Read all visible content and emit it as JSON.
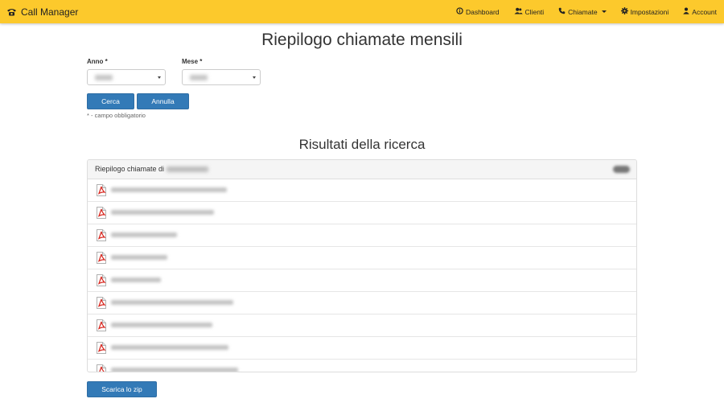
{
  "app": {
    "brand": "Call Manager",
    "brand_icon": "phone-icon",
    "accent_color": "#fcc92c",
    "primary_button_color": "#337ab7"
  },
  "nav": [
    {
      "label": "Dashboard",
      "icon": "info-circle-icon"
    },
    {
      "label": "Clienti",
      "icon": "users-icon"
    },
    {
      "label": "Chiamate",
      "icon": "phone-icon",
      "dropdown": true
    },
    {
      "label": "Impostazioni",
      "icon": "gear-icon"
    },
    {
      "label": "Account",
      "icon": "user-icon"
    }
  ],
  "page": {
    "title": "Riepilogo chiamate mensili",
    "form": {
      "anno_label": "Anno *",
      "mese_label": "Mese *",
      "search_label": "Cerca",
      "cancel_label": "Annulla",
      "required_hint": "* - campo obbligatorio"
    },
    "results": {
      "title": "Risultati della ricerca",
      "panel_heading": "Riepilogo chiamate di",
      "file_icon": "pdf-file-icon",
      "row_count": 9
    },
    "download_label": "Scarica lo zip"
  }
}
